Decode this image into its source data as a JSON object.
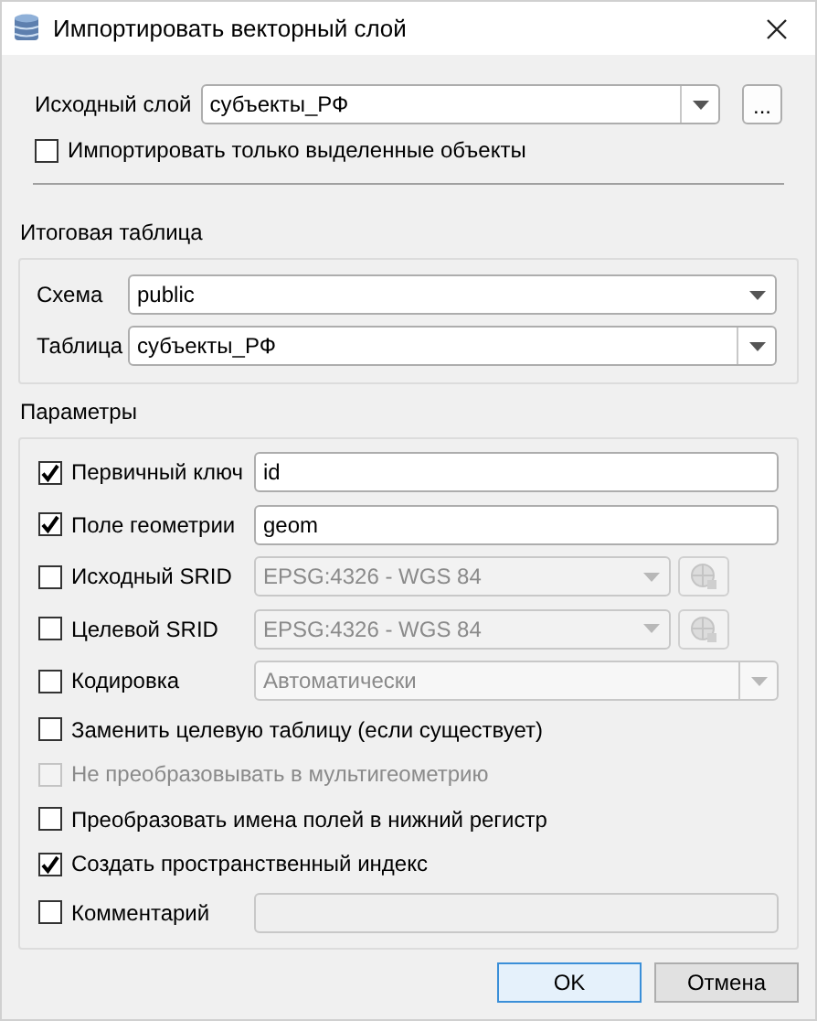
{
  "window": {
    "title": "Импортировать векторный слой"
  },
  "source": {
    "label": "Исходный слой",
    "value": "субъекты_РФ",
    "browse": "..."
  },
  "selected_only": {
    "label": "Импортировать только выделенные объекты",
    "checked": false
  },
  "output": {
    "title": "Итоговая таблица",
    "schema": {
      "label": "Схема",
      "value": "public"
    },
    "table": {
      "label": "Таблица",
      "value": "субъекты_РФ"
    }
  },
  "params": {
    "title": "Параметры",
    "rows": [
      {
        "kind": "text",
        "label": "Первичный ключ",
        "checked": true,
        "disabled": false,
        "value": "id"
      },
      {
        "kind": "text",
        "label": "Поле геометрии",
        "checked": true,
        "disabled": false,
        "value": "geom"
      },
      {
        "kind": "crs",
        "label": "Исходный SRID",
        "checked": false,
        "disabled": true,
        "value": "EPSG:4326 - WGS 84"
      },
      {
        "kind": "crs",
        "label": "Целевой SRID",
        "checked": false,
        "disabled": true,
        "value": "EPSG:4326 - WGS 84"
      },
      {
        "kind": "combo",
        "label": "Кодировка",
        "checked": false,
        "disabled": true,
        "value": "Автоматически"
      },
      {
        "kind": "check",
        "label": "Заменить целевую таблицу (если существует)",
        "checked": false,
        "disabled": false
      },
      {
        "kind": "check",
        "label": "Не преобразовывать в мультигеометрию",
        "checked": false,
        "disabled": true
      },
      {
        "kind": "check",
        "label": "Преобразовать имена полей в нижний регистр",
        "checked": false,
        "disabled": false
      },
      {
        "kind": "check",
        "label": "Создать пространственный индекс",
        "checked": true,
        "disabled": false
      },
      {
        "kind": "text",
        "label": "Комментарий",
        "checked": false,
        "disabled": true
      }
    ]
  },
  "buttons": [
    {
      "label": "OK",
      "default": true
    },
    {
      "label": "Отмена",
      "default": false
    }
  ]
}
